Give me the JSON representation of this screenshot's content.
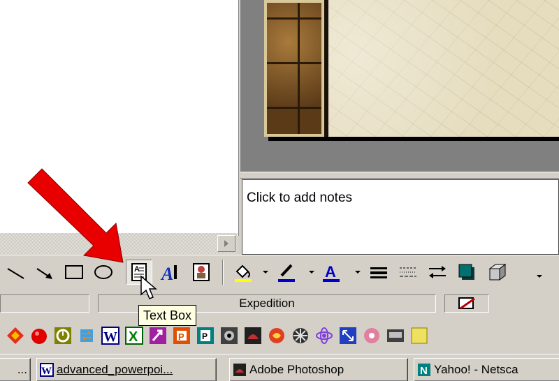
{
  "notes": {
    "placeholder": "Click to add notes"
  },
  "drawing_toolbar": {
    "tools": [
      {
        "name": "line-tool",
        "icon": "line-icon"
      },
      {
        "name": "arrow-tool",
        "icon": "arrow-icon"
      },
      {
        "name": "rectangle-tool",
        "icon": "rectangle-icon"
      },
      {
        "name": "oval-tool",
        "icon": "oval-icon"
      },
      {
        "name": "text-box-tool",
        "icon": "text-box-icon",
        "pressed": true
      },
      {
        "name": "wordart-tool",
        "icon": "wordart-icon"
      },
      {
        "name": "clip-art-tool",
        "icon": "clip-art-icon"
      },
      {
        "name": "fill-color-tool",
        "icon": "paint-bucket-icon"
      },
      {
        "name": "line-color-tool",
        "icon": "pen-icon"
      },
      {
        "name": "font-color-tool",
        "icon": "font-color-icon"
      },
      {
        "name": "line-style-tool",
        "icon": "line-style-icon"
      },
      {
        "name": "dash-style-tool",
        "icon": "dash-style-icon"
      },
      {
        "name": "arrow-style-tool",
        "icon": "arrow-style-icon"
      },
      {
        "name": "shadow-tool",
        "icon": "shadow-icon"
      },
      {
        "name": "3d-tool",
        "icon": "3d-icon"
      }
    ],
    "colors": {
      "accent_red": "#d40000",
      "fill_yellow": "#ffff00",
      "line_blue": "#0000cc",
      "font_blue": "#0000cc"
    }
  },
  "tooltip": {
    "text": "Text Box"
  },
  "status_bar": {
    "design_name": "Expedition"
  },
  "quick_launch": {
    "icons": [
      "diamond-app-icon",
      "red-circle-icon",
      "scheduler-icon",
      "sync-icon",
      "word-icon",
      "excel-icon",
      "access-icon",
      "powerpoint-icon",
      "publisher-icon",
      "camera-icon",
      "photo-icon",
      "swirl-icon",
      "fan-icon",
      "atom-icon",
      "arrows-icon",
      "flower-icon",
      "scanner-icon",
      "extra-icon"
    ]
  },
  "taskbar": {
    "tasks": [
      {
        "label": "...",
        "icon": ""
      },
      {
        "label": "advanced_powerpoi...",
        "icon": "word-icon"
      },
      {
        "label": "Adobe Photoshop",
        "icon": "photoshop-icon"
      },
      {
        "label": "Yahoo! - Netsca",
        "icon": "netscape-icon"
      }
    ]
  },
  "annotation": {
    "arrow_color": "#e80000"
  }
}
